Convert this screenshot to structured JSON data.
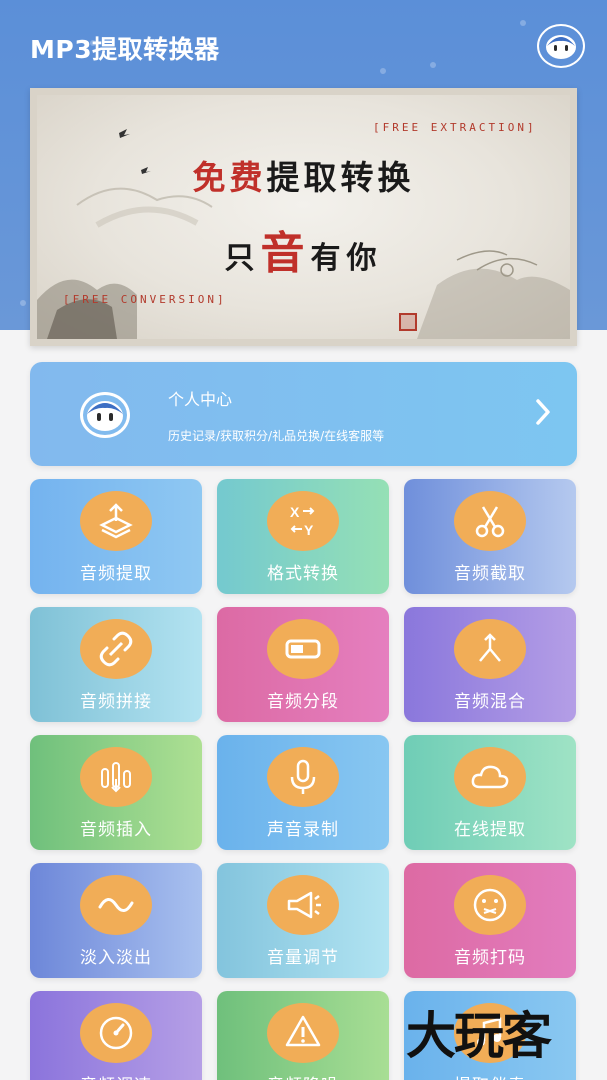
{
  "header": {
    "title": "MP3提取转换器"
  },
  "banner": {
    "tag_top": "[FREE EXTRACTION]",
    "tag_bottom": "[FREE CONVERSION]",
    "line1_red": "免费",
    "line1_rest": "提取转换",
    "line2_a": "只",
    "line2_big": "音",
    "line2_b": "有你"
  },
  "personal": {
    "title": "个人中心",
    "subtitle": "历史记录/获取积分/礼品兑换/在线客服等"
  },
  "tiles": [
    {
      "label": "音频提取",
      "icon": "layers-upload-icon",
      "gradient": [
        "#74b3ef",
        "#8fc8f2"
      ]
    },
    {
      "label": "格式转换",
      "icon": "xy-swap-icon",
      "gradient": [
        "#74c9cf",
        "#95e0b5"
      ]
    },
    {
      "label": "音频截取",
      "icon": "scissors-icon",
      "gradient": [
        "#6f8fdb",
        "#b5c9ef"
      ]
    },
    {
      "label": "音频拼接",
      "icon": "link-icon",
      "gradient": [
        "#7fc1d6",
        "#b3e3f1"
      ]
    },
    {
      "label": "音频分段",
      "icon": "battery-segment-icon",
      "gradient": [
        "#dc6aa4",
        "#e57fbf"
      ]
    },
    {
      "label": "音频混合",
      "icon": "merge-arrow-icon",
      "gradient": [
        "#8a77dc",
        "#b49ee6"
      ]
    },
    {
      "label": "音频插入",
      "icon": "equalizer-insert-icon",
      "gradient": [
        "#6fc07c",
        "#aee093"
      ]
    },
    {
      "label": "声音录制",
      "icon": "microphone-icon",
      "gradient": [
        "#6ab2ec",
        "#88c7f1"
      ]
    },
    {
      "label": "在线提取",
      "icon": "cloud-icon",
      "gradient": [
        "#6fcdb6",
        "#9fe3c5"
      ]
    },
    {
      "label": "淡入淡出",
      "icon": "wave-icon",
      "gradient": [
        "#6d87d9",
        "#a9c1ef"
      ]
    },
    {
      "label": "音量调节",
      "icon": "megaphone-icon",
      "gradient": [
        "#83c4dd",
        "#b2e4f2"
      ]
    },
    {
      "label": "音频打码",
      "icon": "muted-face-icon",
      "gradient": [
        "#dd6aa3",
        "#e27cbe"
      ]
    },
    {
      "label": "音频调速",
      "icon": "speedometer-icon",
      "gradient": [
        "#8b74dc",
        "#b59fe6"
      ]
    },
    {
      "label": "音频降噪",
      "icon": "warning-triangle-icon",
      "gradient": [
        "#6fc07c",
        "#a8de94"
      ]
    },
    {
      "label": "提取伴奏",
      "icon": "accompaniment-icon",
      "gradient": [
        "#6ab2ec",
        "#8ac8f1"
      ]
    }
  ],
  "watermark": "大玩客",
  "colors": {
    "header_bg": "#5b8fd8",
    "icon_circle": "#f1ad57",
    "page_bg": "#f4f4f5"
  }
}
